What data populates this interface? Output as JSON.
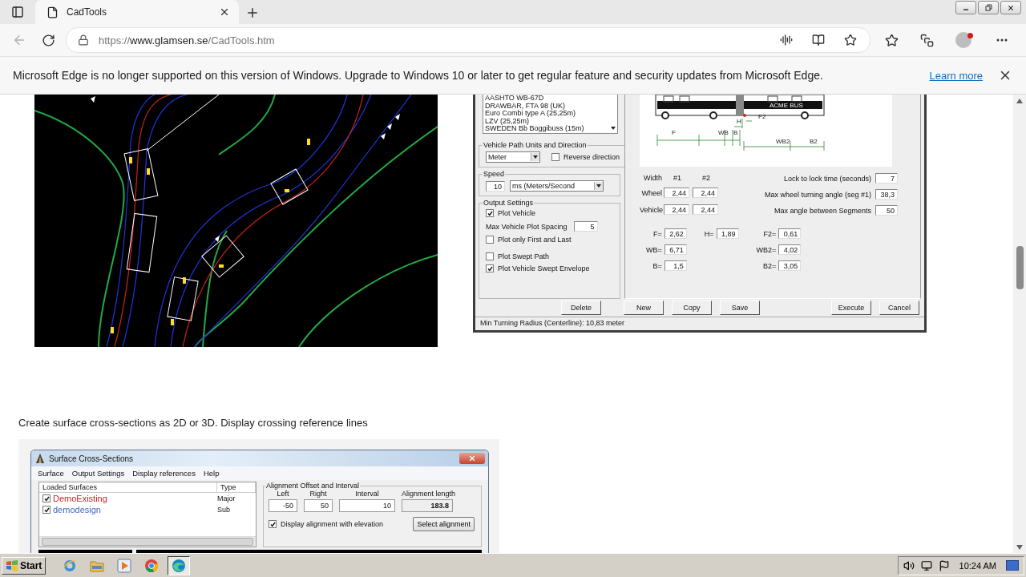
{
  "browser": {
    "tab_title": "CadTools",
    "back": {
      "disabled": true
    },
    "url": {
      "scheme": "https://",
      "host": "www.glamsen.se",
      "path": "/CadTools.htm"
    }
  },
  "infobar": {
    "message": "Microsoft Edge is no longer supported on this version of Windows. Upgrade to Windows 10 or later to get regular feature and security updates from Microsoft Edge.",
    "link": "Learn more"
  },
  "vehicle_dialog": {
    "vehicle_list": [
      "AASHTO WB-67D",
      "DRAWBAR, FTA 98 (UK)",
      "Euro Combi type A (25,25m)",
      "LZV (25,25m)",
      "SWEDEN Bb Boggibuss  (15m)"
    ],
    "path_group": {
      "title": "Vehicle Path Units and Direction",
      "units": "Meter",
      "reverse": {
        "label": "Reverse direction",
        "checked": false
      }
    },
    "speed_group": {
      "title": "Speed",
      "value": "10",
      "unit": "ms (Meters/Second"
    },
    "output_group": {
      "title": "Output Settings",
      "items": [
        {
          "kind": "checkbox",
          "label": "Plot Vehicle",
          "checked": true
        },
        {
          "kind": "number",
          "label": "Max Vehicle Plot Spacing",
          "value": "5"
        },
        {
          "kind": "checkbox",
          "label": "Plot only First and Last",
          "checked": false
        },
        {
          "kind": "checkbox",
          "label": "Plot Swept Path",
          "checked": false
        },
        {
          "kind": "checkbox",
          "label": "Plot Vehicle Swept Envelope",
          "checked": true
        }
      ]
    },
    "bus_label": "ACME BUS",
    "diagram_labels": [
      "F",
      "WB",
      "B",
      "H",
      "F2",
      "WB2",
      "B2"
    ],
    "width_table": {
      "headers": [
        "Width",
        "#1",
        "#2"
      ],
      "rows": [
        {
          "label": "Wheel",
          "values": [
            "2,44",
            "2,44"
          ]
        },
        {
          "label": "Vehicle",
          "values": [
            "2,44",
            "2,44"
          ]
        }
      ]
    },
    "settings": [
      {
        "label": "Lock to lock time (seconds)",
        "value": "7"
      },
      {
        "label": "Max wheel turning angle (seg #1)",
        "value": "38,3"
      },
      {
        "label": "Max angle between Segments",
        "value": "50"
      }
    ],
    "dimension_columns": [
      [
        {
          "label": "F=",
          "value": "2,62"
        },
        {
          "label": "WB=",
          "value": "6,71"
        },
        {
          "label": "B=",
          "value": "1,5"
        }
      ],
      [
        {
          "label": "H=",
          "value": "1,89"
        }
      ],
      [
        {
          "label": "F2=",
          "value": "0,61"
        },
        {
          "label": "WB2=",
          "value": "4,02"
        },
        {
          "label": "B2=",
          "value": "3,05"
        }
      ]
    ],
    "delete_button": "Delete",
    "edit_buttons": [
      "New",
      "Copy",
      "Save"
    ],
    "action_buttons": [
      "Execute",
      "Cancel"
    ],
    "status": "Min Turning Radius (Centerline): 10,83 meter"
  },
  "caption": "Create surface cross-sections as 2D or 3D. Display crossing reference lines",
  "cross_section_window": {
    "title": "Surface Cross-Sections",
    "menu": [
      "Surface",
      "Output Settings",
      "Display references",
      "Help"
    ],
    "surfaces": {
      "columns": [
        "Loaded Surfaces",
        "Type"
      ],
      "rows": [
        {
          "name": "DemoExisting",
          "type": "Major",
          "checked": true,
          "color": "#cc2222"
        },
        {
          "name": "demodesign",
          "type": "Sub",
          "checked": true,
          "color": "#4466bb"
        }
      ]
    },
    "alignment": {
      "title": "Alignment Offset and Interval",
      "fields": [
        {
          "kind": "input",
          "label": "Left",
          "value": "-50"
        },
        {
          "kind": "input",
          "label": "Right",
          "value": "50"
        },
        {
          "kind": "input",
          "label": "Interval",
          "value": "10"
        },
        {
          "kind": "readonly",
          "label": "Alignment length",
          "value": "183.8"
        }
      ],
      "elevation": {
        "label": "Display alignment with elevation",
        "checked": true
      },
      "button": "Select alignment"
    }
  },
  "taskbar": {
    "start": "Start",
    "apps": [
      {
        "kind": "ie",
        "selected": false
      },
      {
        "kind": "folder",
        "selected": false
      },
      {
        "kind": "media",
        "selected": false
      },
      {
        "kind": "chrome",
        "selected": false
      },
      {
        "kind": "edge",
        "selected": true
      }
    ],
    "clock": "10:24 AM"
  }
}
